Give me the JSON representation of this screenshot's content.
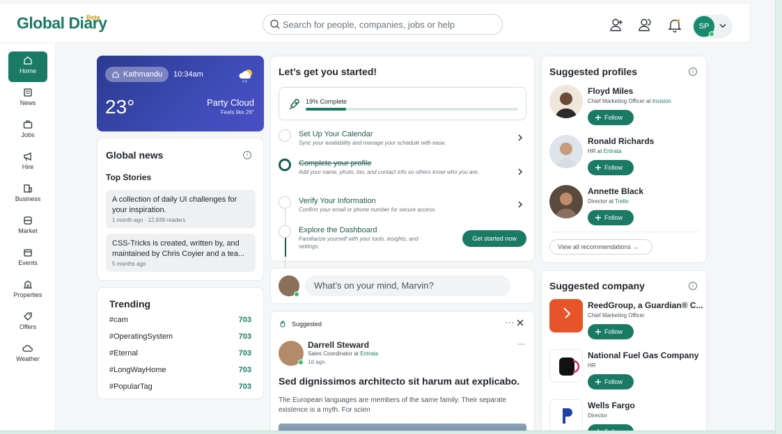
{
  "brand": {
    "name": "Global Diary",
    "badge": "Beta"
  },
  "search": {
    "placeholder": "Search for people, companies, jobs or help"
  },
  "user": {
    "initials": "SP"
  },
  "nav": [
    {
      "label": "Home",
      "icon": "home-icon"
    },
    {
      "label": "News",
      "icon": "news-icon"
    },
    {
      "label": "Jobs",
      "icon": "briefcase-icon"
    },
    {
      "label": "Hire",
      "icon": "megaphone-icon"
    },
    {
      "label": "Business",
      "icon": "building-icon"
    },
    {
      "label": "Market",
      "icon": "market-icon"
    },
    {
      "label": "Events",
      "icon": "calendar-icon"
    },
    {
      "label": "Properties",
      "icon": "properties-icon"
    },
    {
      "label": "Offers",
      "icon": "tag-icon"
    },
    {
      "label": "Weather",
      "icon": "cloud-icon"
    }
  ],
  "weather": {
    "location": "Kathmandu",
    "time": "10:34am",
    "temp": "23°",
    "condition": "Party Cloud",
    "feels": "Feels like 26°"
  },
  "news": {
    "title": "Global news",
    "subtitle": "Top Stories",
    "stories": [
      {
        "title": "A collection of daily UI challenges for your inspiration.",
        "meta": "1 month ago · 12,839 readers"
      },
      {
        "title": "CSS-Tricks is created, written by, and maintained by Chris Coyier and a tea...",
        "meta": "5 months ago"
      }
    ]
  },
  "trending": {
    "title": "Trending",
    "items": [
      {
        "tag": "#cam",
        "count": "703"
      },
      {
        "tag": "#OperatingSystem",
        "count": "703"
      },
      {
        "tag": "#Eternal",
        "count": "703"
      },
      {
        "tag": "#LongWayHome",
        "count": "703"
      },
      {
        "tag": "#PopularTag",
        "count": "703"
      }
    ]
  },
  "onboarding": {
    "title": "Let’s get you started!",
    "progress_label": "19% Complete",
    "progress": 0.19,
    "steps": [
      {
        "title": "Set Up Your Calendar",
        "desc": "Sync your availability and manage your schedule with ease."
      },
      {
        "title": "Complete your profile",
        "desc": "Add your name, photo, bio, and contact info so others know who you are."
      },
      {
        "title": "Verify Your Information",
        "desc": "Confirm your email or phone number for secure access."
      },
      {
        "title": "Explore the Dashboard",
        "desc": "Familiarize yourself with your tools, insights, and settings."
      }
    ],
    "cta": "Get started now"
  },
  "composer": {
    "placeholder": "What’s on your mind, Marvin?"
  },
  "post": {
    "label": "Suggested",
    "author": "Darrell Steward",
    "role": "Sales Coordinator",
    "at": "at",
    "company": "Entrata",
    "time": "1d ago",
    "headline": "Sed dignissimos architecto sit harum aut explicabo.",
    "body": "The European languages are members of the same family. Their separate existence is a myth. For scien"
  },
  "suggested_profiles": {
    "title": "Suggested profiles",
    "follow_label": "Follow",
    "view_all": "View all recommendations →",
    "items": [
      {
        "name": "Floyd Miles",
        "role": "Chief Marketing Officer",
        "at": "at",
        "company": "Invision"
      },
      {
        "name": "Ronald Richards",
        "role": "HR",
        "at": "at",
        "company": "Entrata"
      },
      {
        "name": "Annette Black",
        "role": "Director",
        "at": "at",
        "company": "Trello"
      }
    ]
  },
  "suggested_company": {
    "title": "Suggested company",
    "items": [
      {
        "name": "ReedGroup, a Guardian® C...",
        "role": "Chief Marketing Officer"
      },
      {
        "name": "National Fuel Gas Company",
        "role": "HR"
      },
      {
        "name": "Wells Fargo",
        "role": "Director"
      }
    ]
  },
  "colors": {
    "accent": "#1a7a64",
    "weather_bg": "#3e4bb5"
  }
}
